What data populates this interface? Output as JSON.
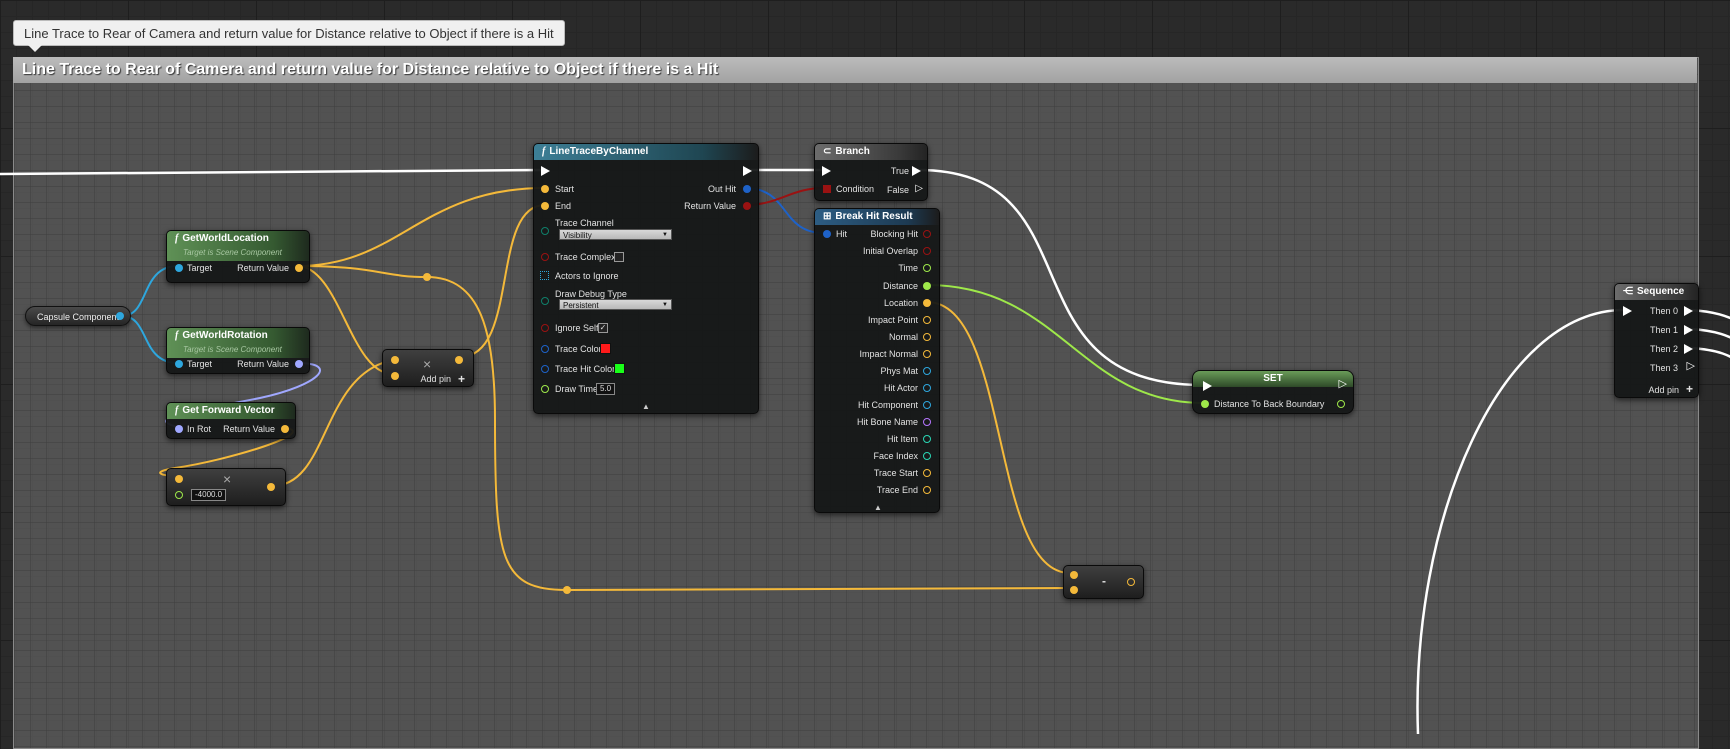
{
  "comment": {
    "bubble": "Line Trace to Rear of Camera and return value for Distance relative to Object if there is a Hit",
    "title": "Line Trace to Rear of Camera and return value for Distance relative to Object if there is a Hit"
  },
  "colors": {
    "wire_exec": "#ffffff",
    "wire_vector": "#f4b93a",
    "wire_object": "#2ea7de",
    "wire_rotator": "#a0a8ff",
    "wire_float": "#9ee84a",
    "wire_struct": "#1e62c8",
    "wire_bool": "#9a1212",
    "trace_color": "#ff1a1a",
    "trace_hit_color": "#19ff19"
  },
  "capsule": {
    "label": "Capsule Component"
  },
  "get_world_location": {
    "title": "GetWorldLocation",
    "subtitle": "Target is Scene Component",
    "target": "Target",
    "return": "Return Value"
  },
  "get_world_rotation": {
    "title": "GetWorldRotation",
    "subtitle": "Target is Scene Component",
    "target": "Target",
    "return": "Return Value"
  },
  "get_forward_vector": {
    "title": "Get Forward Vector",
    "in_rot": "In Rot",
    "return": "Return Value"
  },
  "multiply": {
    "symbol": "×",
    "value": "-4000.0"
  },
  "add": {
    "symbol": "×",
    "add_pin": "Add pin",
    "plus": "+"
  },
  "line_trace": {
    "title": "LineTraceByChannel",
    "start": "Start",
    "end": "End",
    "out_hit": "Out Hit",
    "return": "Return Value",
    "trace_channel": "Trace Channel",
    "trace_channel_value": "Visibility",
    "trace_complex": "Trace Complex",
    "actors_to_ignore": "Actors to Ignore",
    "draw_debug_type": "Draw Debug Type",
    "draw_debug_value": "Persistent",
    "ignore_self": "Ignore Self",
    "ignore_self_check": "✓",
    "trace_color": "Trace Color",
    "trace_hit_color": "Trace Hit Color",
    "draw_time": "Draw Time",
    "draw_time_value": "5.0",
    "expander": "▲"
  },
  "branch": {
    "title": "Branch",
    "condition": "Condition",
    "true": "True",
    "false": "False"
  },
  "break_hit": {
    "title": "Break Hit Result",
    "hit": "Hit",
    "outputs": [
      "Blocking Hit",
      "Initial Overlap",
      "Time",
      "Distance",
      "Location",
      "Impact Point",
      "Normal",
      "Impact Normal",
      "Phys Mat",
      "Hit Actor",
      "Hit Component",
      "Hit Bone Name",
      "Hit Item",
      "Face Index",
      "Trace Start",
      "Trace End"
    ],
    "expander": "▲"
  },
  "set": {
    "title": "SET",
    "var": "Distance To Back Boundary"
  },
  "subtract": {
    "symbol": "-"
  },
  "sequence": {
    "title": "Sequence",
    "then0": "Then 0",
    "then1": "Then 1",
    "then2": "Then 2",
    "then3": "Then 3",
    "add_pin": "Add pin",
    "plus": "+"
  }
}
